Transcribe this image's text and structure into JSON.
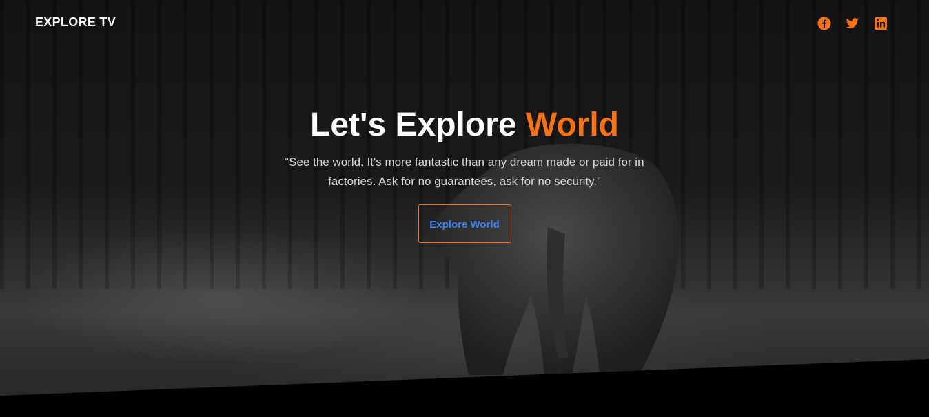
{
  "nav": {
    "brand": "EXPLORE TV",
    "social": [
      {
        "name": "facebook-icon",
        "color": "#f97316"
      },
      {
        "name": "twitter-icon",
        "color": "#f97316"
      },
      {
        "name": "linkedin-icon",
        "color": "#f97316"
      }
    ]
  },
  "hero": {
    "title_main": "Let's Explore ",
    "title_accent": "World",
    "quote": "“See the world. It's more fantastic than any dream made or paid for in factories. Ask for no guarantees, ask for no security.”",
    "cta_label": "Explore World"
  },
  "colors": {
    "accent": "#f97316",
    "link": "#3b82f6",
    "text": "#ffffff"
  }
}
